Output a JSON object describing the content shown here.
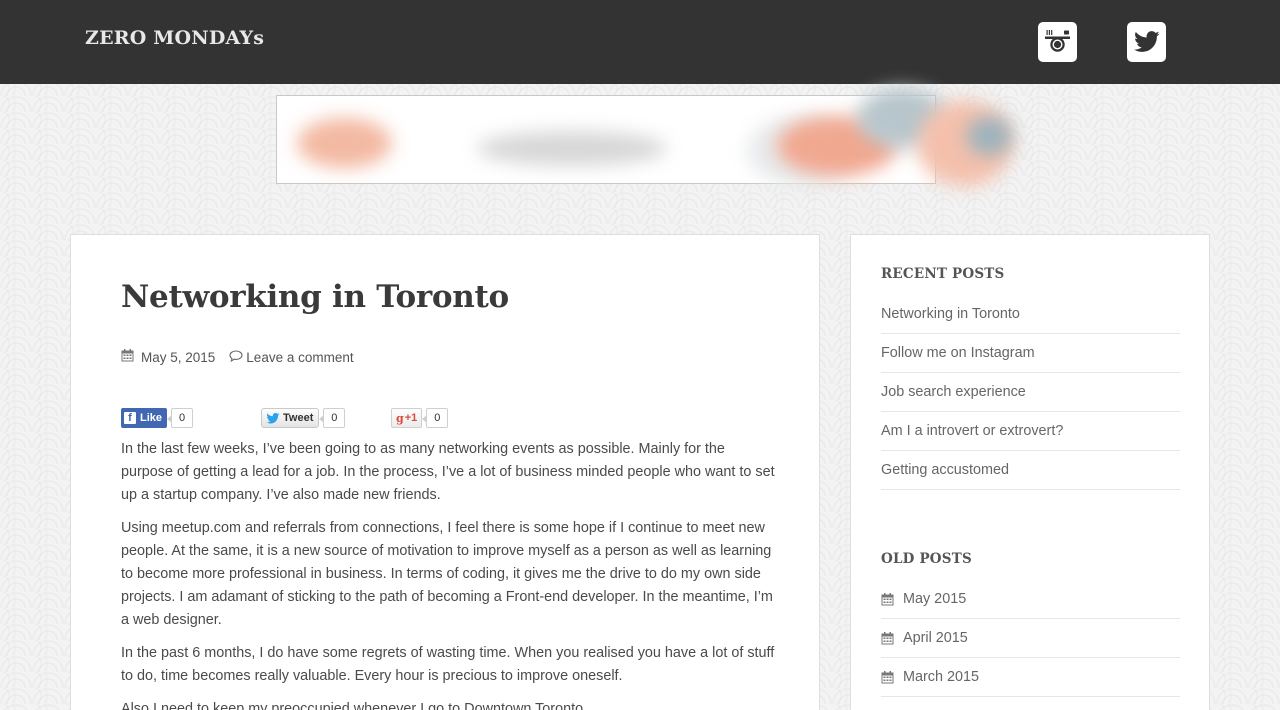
{
  "site": {
    "title": "ZERO MONDAYs"
  },
  "social": [
    {
      "name": "instagram-icon"
    },
    {
      "name": "twitter-icon"
    }
  ],
  "post": {
    "title": "Networking in Toronto",
    "date": "May 5, 2015",
    "comment_link": "Leave a comment",
    "share": {
      "like_label": "Like",
      "like_count": "0",
      "tweet_label": "Tweet",
      "tweet_count": "0",
      "gplus_label": "+1",
      "gplus_count": "0"
    },
    "paragraphs": [
      "In the last few weeks, I’ve been going to as many networking events as possible. Mainly for the purpose of getting a lead for a job. In the process, I’ve a lot of business minded people who want to set up a startup company. I’ve also made new friends.",
      "Using meetup.com and referrals from connections, I feel there is some hope if I continue to meet new people. At the same, it is a new source of motivation to improve myself as a person as well as learning to become more professional in business. In terms of coding, it gives me the drive to do my own side projects. I am adamant of sticking to the path of becoming a Front-end developer. In the meantime, I’m a web designer.",
      "In the past 6 months, I do have some regrets of wasting time. When you realised you have a lot of stuff to do, time becomes really valuable. Every hour is precious to improve oneself.",
      "Also I need to keep my preoccupied whenever I go to Downtown Toronto."
    ]
  },
  "sidebar": {
    "recent_title": "RECENT POSTS",
    "recent": [
      {
        "label": "Networking in Toronto"
      },
      {
        "label": "Follow me on Instagram"
      },
      {
        "label": "Job search experience"
      },
      {
        "label": "Am I a introvert or extrovert?"
      },
      {
        "label": "Getting accustomed"
      }
    ],
    "old_title": "OLD POSTS",
    "old": [
      {
        "label": "May 2015"
      },
      {
        "label": "April 2015"
      },
      {
        "label": "March 2015"
      }
    ]
  }
}
